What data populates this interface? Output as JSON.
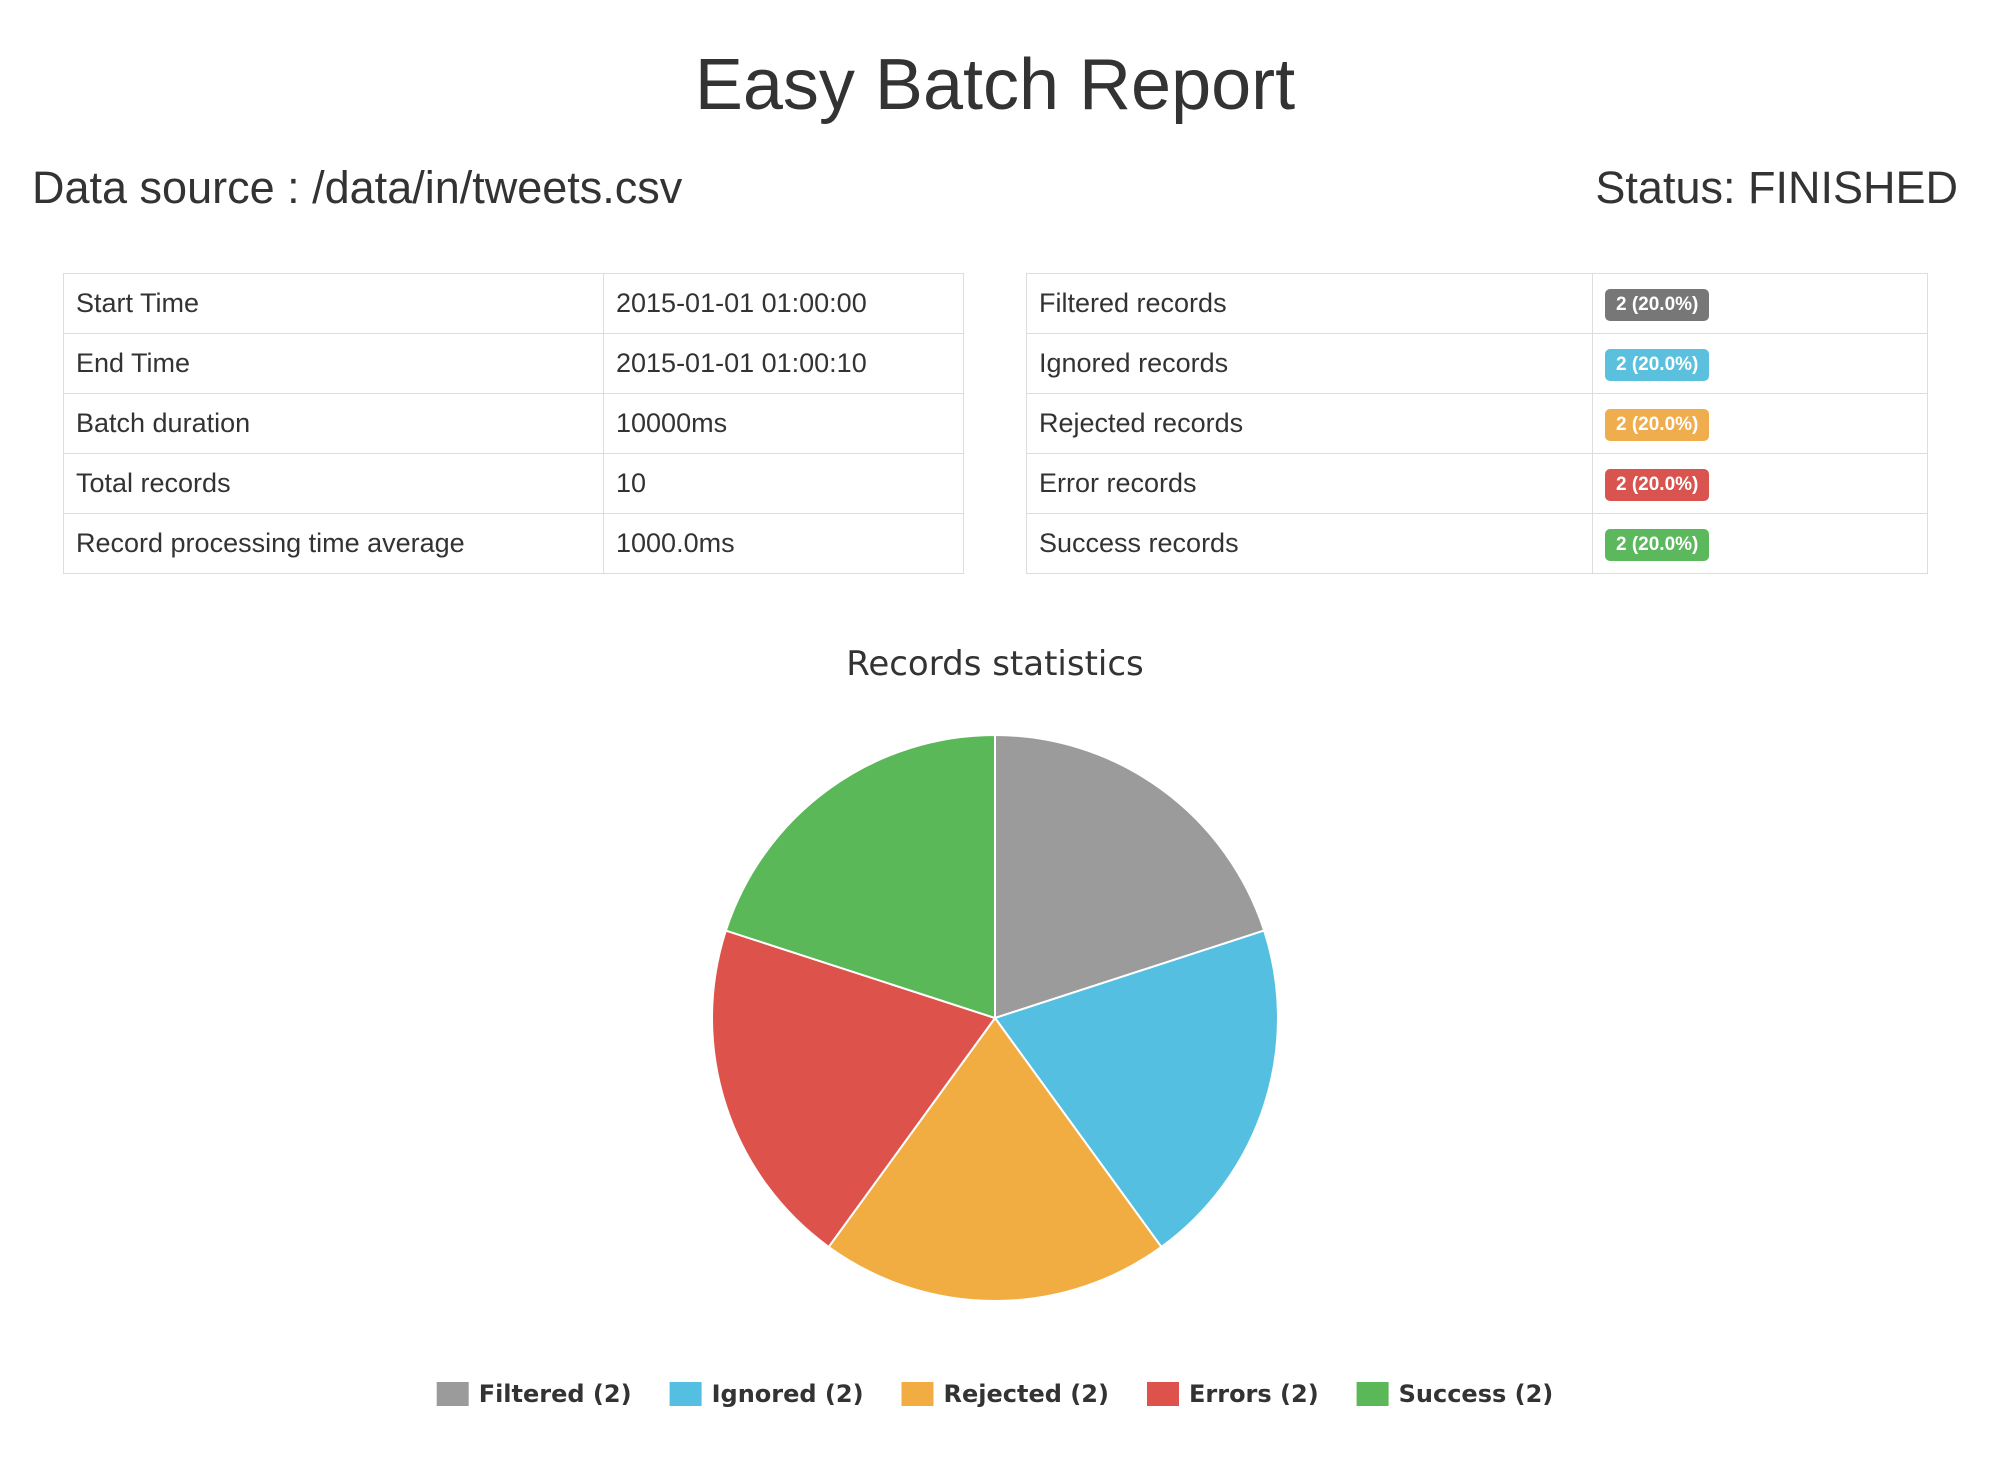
{
  "report": {
    "title": "Easy Batch Report",
    "data_source": "Data source : /data/in/tweets.csv",
    "status": "Status: FINISHED"
  },
  "metrics": [
    {
      "label": "Start Time",
      "value": "2015-01-01 01:00:00"
    },
    {
      "label": "End Time",
      "value": "2015-01-01 01:00:10"
    },
    {
      "label": "Batch duration",
      "value": "10000ms"
    },
    {
      "label": "Total records",
      "value": "10"
    },
    {
      "label": "Record processing time average",
      "value": "1000.0ms"
    }
  ],
  "records": [
    {
      "label": "Filtered records",
      "badge": "2 (20.0%)",
      "color": "#777777"
    },
    {
      "label": "Ignored records",
      "badge": "2 (20.0%)",
      "color": "#5bc0de"
    },
    {
      "label": "Rejected records",
      "badge": "2 (20.0%)",
      "color": "#f0ad4e"
    },
    {
      "label": "Error records",
      "badge": "2 (20.0%)",
      "color": "#d9534f"
    },
    {
      "label": "Success records",
      "badge": "2 (20.0%)",
      "color": "#5cb85c"
    }
  ],
  "chart_data": {
    "type": "pie",
    "title": "Records statistics",
    "legend_position": "bottom",
    "slices": [
      {
        "name": "Filtered (2)",
        "value": 2,
        "color": "#9b9b9b"
      },
      {
        "name": "Ignored (2)",
        "value": 2,
        "color": "#55bfe1"
      },
      {
        "name": "Rejected (2)",
        "value": 2,
        "color": "#f2ad42"
      },
      {
        "name": "Errors (2)",
        "value": 2,
        "color": "#dd534b"
      },
      {
        "name": "Success (2)",
        "value": 2,
        "color": "#5bb858"
      }
    ]
  }
}
